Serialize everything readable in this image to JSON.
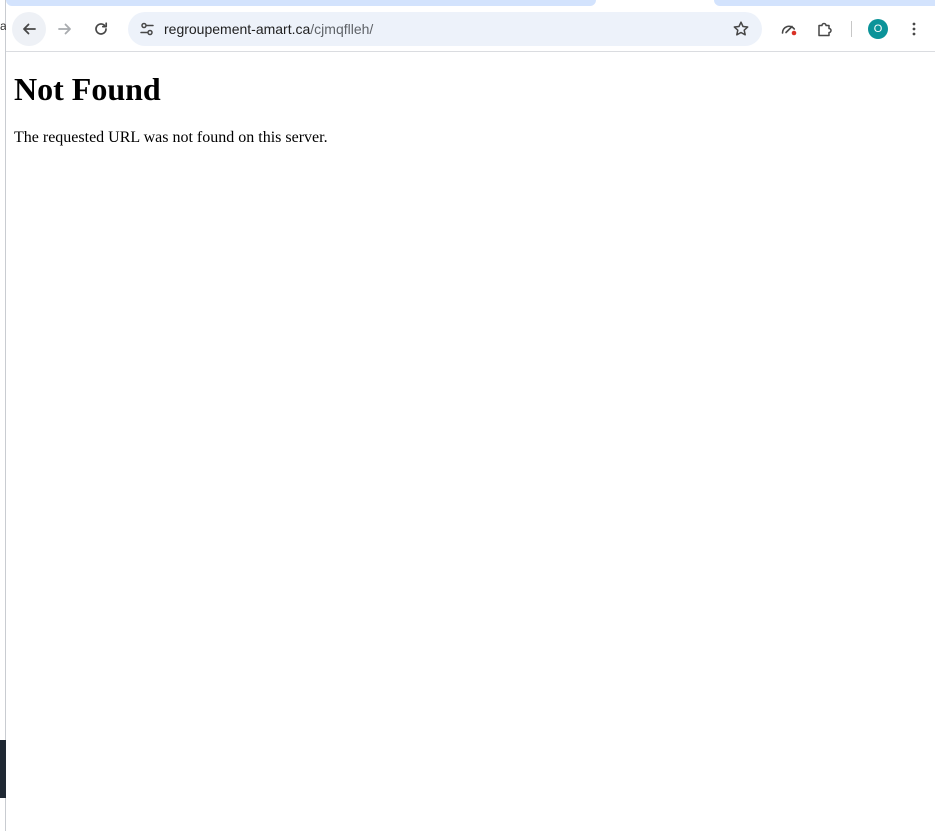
{
  "left_window": {
    "glyph": "a"
  },
  "toolbar": {
    "back_icon": "arrow-left-icon",
    "forward_icon": "arrow-right-icon",
    "reload_icon": "reload-icon"
  },
  "omnibox": {
    "host": "regroupement-amart.ca",
    "path": "/cjmqflleh/",
    "site_info_icon": "tune-icon",
    "bookmark_icon": "star-icon"
  },
  "profile": {
    "initial": "O",
    "color": "#0b9399"
  },
  "page": {
    "heading": "Not Found",
    "message": "The requested URL was not found on this server."
  },
  "colors": {
    "tab_active_bg": "#d3e3fd",
    "omnibox_bg": "#edf2fa"
  }
}
